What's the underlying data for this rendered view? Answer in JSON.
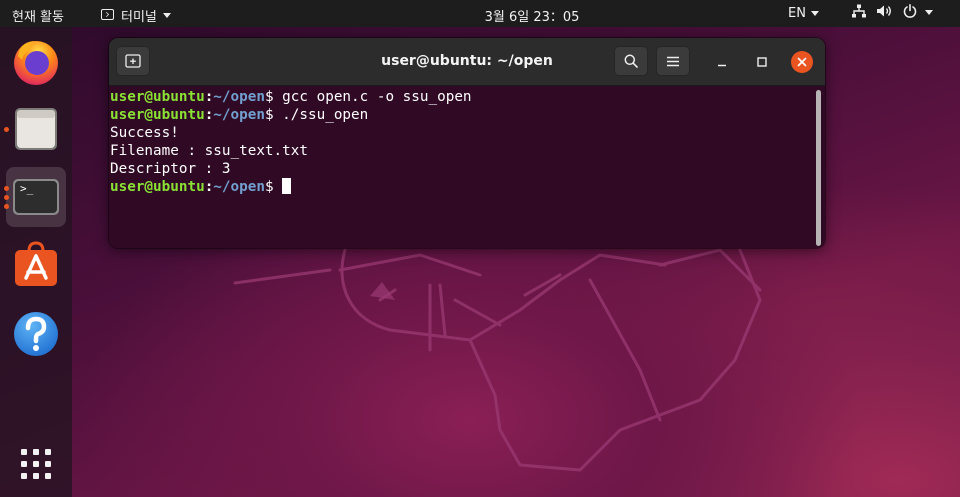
{
  "topbar": {
    "activities_label": "현재 활동",
    "app_menu_label": "터미널",
    "clock": "3월 6일  23：05",
    "language": "EN",
    "status_icons": [
      "network-icon",
      "volume-icon",
      "power-icon"
    ]
  },
  "dock": {
    "apps": [
      "firefox-icon",
      "files-icon",
      "terminal-icon",
      "software-center-icon",
      "help-icon",
      "show-applications-icon"
    ],
    "terminal_glyph": ">_",
    "running_accent": "#e95420"
  },
  "terminal": {
    "title": "user@ubuntu: ~/open",
    "prompt": {
      "user_host": "user@ubuntu",
      "colon": ":",
      "path": "~/open",
      "dollar": "$"
    },
    "commands": [
      " gcc open.c -o ssu_open",
      " ./ssu_open"
    ],
    "output": [
      "Success!",
      "Filename : ssu_text.txt",
      "Descriptor : 3"
    ],
    "colors": {
      "background": "#300a24",
      "prompt_user": "#8ae234",
      "prompt_path": "#729fcf",
      "close_button": "#e95420"
    }
  }
}
